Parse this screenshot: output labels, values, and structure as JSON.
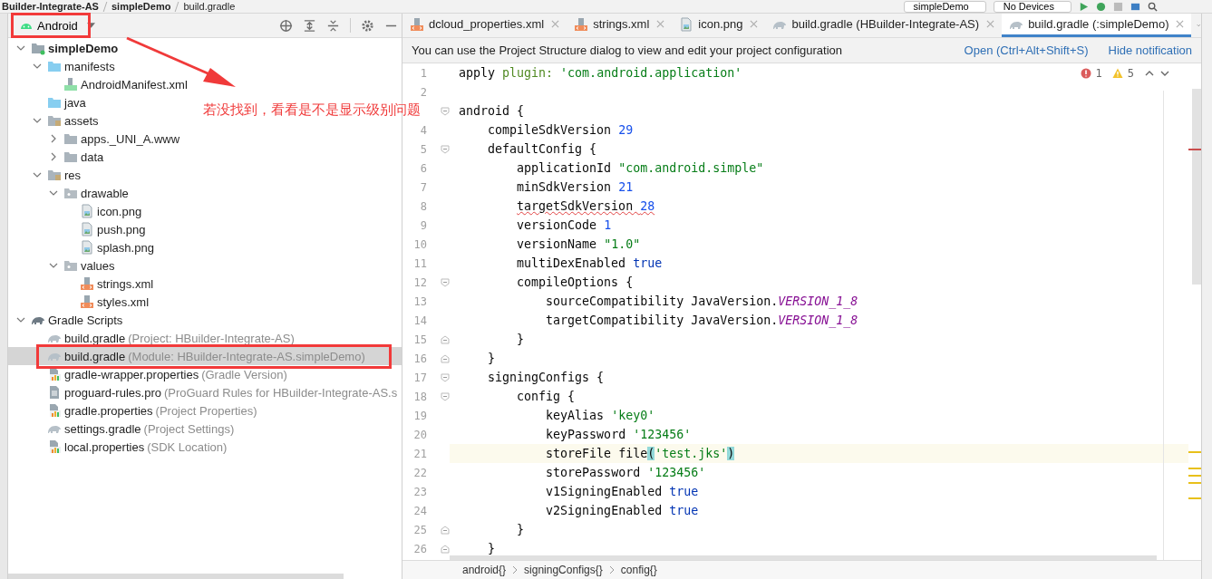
{
  "breadcrumb": [
    "Builder-Integrate-AS",
    "simpleDemo",
    "build.gradle"
  ],
  "toolbar": {
    "config": "simpleDemo",
    "device": "No Devices"
  },
  "project_panel": {
    "view": "Android",
    "tree": [
      {
        "label": "simpleDemo",
        "kind": "module",
        "expanded": true,
        "selected": false,
        "children": [
          {
            "label": "manifests",
            "kind": "source-folder",
            "expanded": true,
            "selected": false,
            "children": [
              {
                "label": "AndroidManifest.xml",
                "kind": "manifest",
                "selected": false
              }
            ]
          },
          {
            "label": "java",
            "kind": "source-folder",
            "selected": false
          },
          {
            "label": "assets",
            "kind": "resource-folder",
            "expanded": true,
            "selected": false,
            "children": [
              {
                "label": "apps._UNI_A.www",
                "kind": "folder",
                "expanded": false,
                "selected": false
              },
              {
                "label": "data",
                "kind": "folder",
                "expanded": false,
                "selected": false
              }
            ]
          },
          {
            "label": "res",
            "kind": "resource-folder",
            "expanded": true,
            "selected": false,
            "children": [
              {
                "label": "drawable",
                "kind": "package",
                "expanded": true,
                "selected": false,
                "children": [
                  {
                    "label": "icon.png",
                    "kind": "image",
                    "selected": false
                  },
                  {
                    "label": "push.png",
                    "kind": "image",
                    "selected": false
                  },
                  {
                    "label": "splash.png",
                    "kind": "image",
                    "selected": false
                  }
                ]
              },
              {
                "label": "values",
                "kind": "package",
                "expanded": true,
                "selected": false,
                "children": [
                  {
                    "label": "strings.xml",
                    "kind": "xml",
                    "selected": false
                  },
                  {
                    "label": "styles.xml",
                    "kind": "xml",
                    "selected": false
                  }
                ]
              }
            ]
          }
        ]
      },
      {
        "label": "Gradle Scripts",
        "kind": "scripts",
        "expanded": true,
        "selected": false,
        "children": [
          {
            "label": "build.gradle",
            "detail": "(Project: HBuilder-Integrate-AS)",
            "kind": "gradle",
            "selected": false
          },
          {
            "label": "build.gradle",
            "detail": "(Module: HBuilder-Integrate-AS.simpleDemo)",
            "kind": "gradle",
            "selected": true
          },
          {
            "label": "gradle-wrapper.properties",
            "detail": "(Gradle Version)",
            "kind": "properties",
            "selected": false
          },
          {
            "label": "proguard-rules.pro",
            "detail": "(ProGuard Rules for HBuilder-Integrate-AS.s",
            "kind": "text",
            "selected": false
          },
          {
            "label": "gradle.properties",
            "detail": "(Project Properties)",
            "kind": "properties",
            "selected": false
          },
          {
            "label": "settings.gradle",
            "detail": "(Project Settings)",
            "kind": "gradle",
            "selected": false
          },
          {
            "label": "local.properties",
            "detail": "(SDK Location)",
            "kind": "properties",
            "selected": false
          }
        ]
      }
    ]
  },
  "annotation": {
    "text": "若没找到，看看是不是显示级别问题"
  },
  "tabs": [
    {
      "label": "dcloud_properties.xml",
      "kind": "xml",
      "selected": false
    },
    {
      "label": "strings.xml",
      "kind": "xml",
      "selected": false
    },
    {
      "label": "icon.png",
      "kind": "image",
      "selected": false
    },
    {
      "label": "build.gradle (HBuilder-Integrate-AS)",
      "kind": "gradle",
      "selected": false
    },
    {
      "label": "build.gradle (:simpleDemo)",
      "kind": "gradle",
      "selected": true
    }
  ],
  "notification": {
    "text": "You can use the Project Structure dialog to view and edit your project configuration",
    "actions": [
      "Open (Ctrl+Alt+Shift+S)",
      "Hide notification"
    ]
  },
  "inspections": {
    "errors": "1",
    "warnings": "5"
  },
  "code": [
    {
      "number": "1",
      "kind": "code",
      "current": false,
      "warning": false,
      "segments": [
        {
          "text": "apply ",
          "kind": "plain"
        },
        {
          "text": "plugin:",
          "kind": "label"
        },
        {
          "text": " 'com.android.application'",
          "kind": "string"
        }
      ]
    },
    {
      "number": "2",
      "kind": "code",
      "current": false
    },
    {
      "kind": "fold-start",
      "current": false,
      "warning": false,
      "segments": [
        {
          "text": "android {",
          "kind": "plain"
        }
      ]
    },
    {
      "number": "4",
      "kind": "code",
      "current": false,
      "warning": false,
      "segments": [
        {
          "text": "    compileSdkVersion ",
          "kind": "plain"
        },
        {
          "text": "29",
          "kind": "number"
        }
      ]
    },
    {
      "number": "5",
      "kind": "fold-start",
      "current": false,
      "warning": false,
      "segments": [
        {
          "text": "    defaultConfig {",
          "kind": "plain"
        }
      ]
    },
    {
      "number": "6",
      "kind": "code",
      "current": false,
      "warning": false,
      "segments": [
        {
          "text": "        applicationId ",
          "kind": "plain"
        },
        {
          "text": "\"com.android.simple\"",
          "kind": "string"
        }
      ]
    },
    {
      "number": "7",
      "kind": "code",
      "current": false,
      "warning": false,
      "segments": [
        {
          "text": "        minSdkVersion ",
          "kind": "plain"
        },
        {
          "text": "21",
          "kind": "number"
        }
      ]
    },
    {
      "number": "8",
      "kind": "code",
      "current": false,
      "warning": true,
      "segments": [
        {
          "text": "        targetSdkVersion ",
          "kind": "plain"
        },
        {
          "text": "28",
          "kind": "number"
        }
      ]
    },
    {
      "number": "9",
      "kind": "code",
      "current": false,
      "warning": false,
      "segments": [
        {
          "text": "        versionCode ",
          "kind": "plain"
        },
        {
          "text": "1",
          "kind": "number"
        }
      ]
    },
    {
      "number": "10",
      "kind": "code",
      "current": false,
      "warning": false,
      "segments": [
        {
          "text": "        versionName ",
          "kind": "plain"
        },
        {
          "text": "\"1.0\"",
          "kind": "string"
        }
      ]
    },
    {
      "number": "11",
      "kind": "code",
      "current": false,
      "warning": false,
      "segments": [
        {
          "text": "        multiDexEnabled ",
          "kind": "plain"
        },
        {
          "text": "true",
          "kind": "keyword"
        }
      ]
    },
    {
      "number": "12",
      "kind": "fold-start",
      "current": false,
      "warning": false,
      "segments": [
        {
          "text": "        compileOptions {",
          "kind": "plain"
        }
      ]
    },
    {
      "number": "13",
      "kind": "code",
      "current": false,
      "warning": false,
      "segments": [
        {
          "text": "            sourceCompatibility JavaVersion.",
          "kind": "plain"
        },
        {
          "text": "VERSION_1_8",
          "kind": "constant"
        }
      ]
    },
    {
      "number": "14",
      "kind": "code",
      "current": false,
      "warning": false,
      "segments": [
        {
          "text": "            targetCompatibility JavaVersion.",
          "kind": "plain"
        },
        {
          "text": "VERSION_1_8",
          "kind": "constant"
        }
      ]
    },
    {
      "number": "15",
      "kind": "fold-end",
      "current": false,
      "warning": false,
      "segments": [
        {
          "text": "        }",
          "kind": "plain"
        }
      ]
    },
    {
      "number": "16",
      "kind": "fold-end",
      "current": false,
      "warning": false,
      "segments": [
        {
          "text": "    }",
          "kind": "plain"
        }
      ]
    },
    {
      "number": "17",
      "kind": "fold-start",
      "current": false,
      "warning": false,
      "segments": [
        {
          "text": "    signingConfigs {",
          "kind": "plain"
        }
      ]
    },
    {
      "number": "18",
      "kind": "fold-start",
      "current": false,
      "warning": false,
      "segments": [
        {
          "text": "        config {",
          "kind": "plain"
        }
      ]
    },
    {
      "number": "19",
      "kind": "code",
      "current": false,
      "warning": false,
      "segments": [
        {
          "text": "            keyAlias ",
          "kind": "plain"
        },
        {
          "text": "'key0'",
          "kind": "string"
        }
      ]
    },
    {
      "number": "20",
      "kind": "code",
      "current": false,
      "warning": false,
      "segments": [
        {
          "text": "            keyPassword ",
          "kind": "plain"
        },
        {
          "text": "'123456'",
          "kind": "string"
        }
      ]
    },
    {
      "number": "21",
      "kind": "code",
      "current": true,
      "warning": false,
      "segments": [
        {
          "text": "            storeFile file",
          "kind": "plain"
        },
        {
          "text": "(",
          "kind": "match"
        },
        {
          "text": "'test.jks'",
          "kind": "string"
        },
        {
          "text": ")",
          "kind": "match"
        }
      ]
    },
    {
      "number": "22",
      "kind": "code",
      "current": false,
      "warning": false,
      "segments": [
        {
          "text": "            storePassword ",
          "kind": "plain"
        },
        {
          "text": "'123456'",
          "kind": "string"
        }
      ]
    },
    {
      "number": "23",
      "kind": "code",
      "current": false,
      "warning": false,
      "segments": [
        {
          "text": "            v1SigningEnabled ",
          "kind": "plain"
        },
        {
          "text": "true",
          "kind": "keyword"
        }
      ]
    },
    {
      "number": "24",
      "kind": "code",
      "current": false,
      "warning": false,
      "segments": [
        {
          "text": "            v2SigningEnabled ",
          "kind": "plain"
        },
        {
          "text": "true",
          "kind": "keyword"
        }
      ]
    },
    {
      "number": "25",
      "kind": "fold-end",
      "current": false,
      "warning": false,
      "segments": [
        {
          "text": "        }",
          "kind": "plain"
        }
      ]
    },
    {
      "number": "26",
      "kind": "fold-end",
      "current": false,
      "warning": false,
      "segments": [
        {
          "text": "    }",
          "kind": "plain"
        }
      ]
    }
  ],
  "breadcrumbs": [
    "android{}",
    "signingConfigs{}",
    "config{}"
  ]
}
